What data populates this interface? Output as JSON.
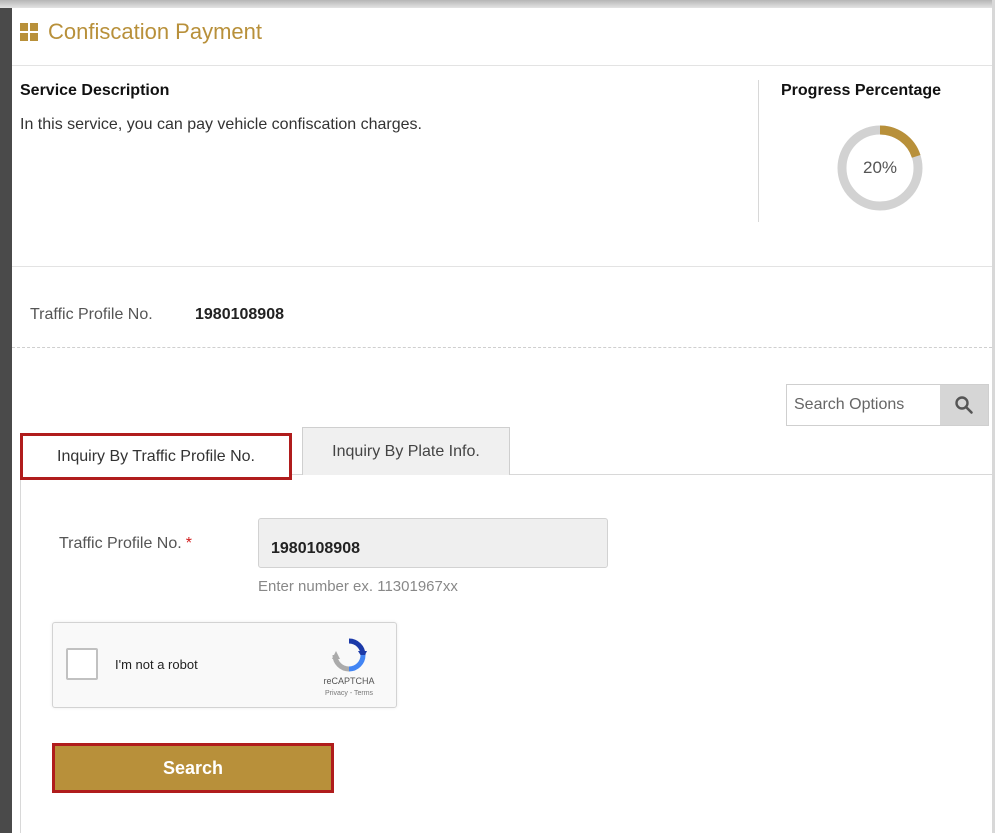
{
  "header": {
    "title": "Confiscation Payment",
    "icon": "grid-icon",
    "accent_color": "#b8903a"
  },
  "service": {
    "label": "Service Description",
    "description": "In this service, you can pay vehicle confiscation charges."
  },
  "progress": {
    "label": "Progress Percentage",
    "value_text": "20%",
    "value": 20,
    "fill_color": "#b8903a",
    "track_color": "#d2d2d2"
  },
  "profile": {
    "label": "Traffic Profile No.",
    "value": "1980108908"
  },
  "search_options": {
    "placeholder": "Search Options",
    "icon": "search-icon"
  },
  "tabs": [
    {
      "label": "Inquiry By Traffic Profile No.",
      "active": true
    },
    {
      "label": "Inquiry By Plate Info.",
      "active": false
    }
  ],
  "form": {
    "field_label": "Traffic Profile No.",
    "required_mark": "*",
    "field_value": "1980108908",
    "hint": "Enter number ex. 11301967xx"
  },
  "captcha": {
    "label": "I'm not a robot",
    "brand": "reCAPTCHA",
    "links": "Privacy - Terms"
  },
  "actions": {
    "search_label": "Search",
    "highlight_color": "#b01c1c"
  }
}
